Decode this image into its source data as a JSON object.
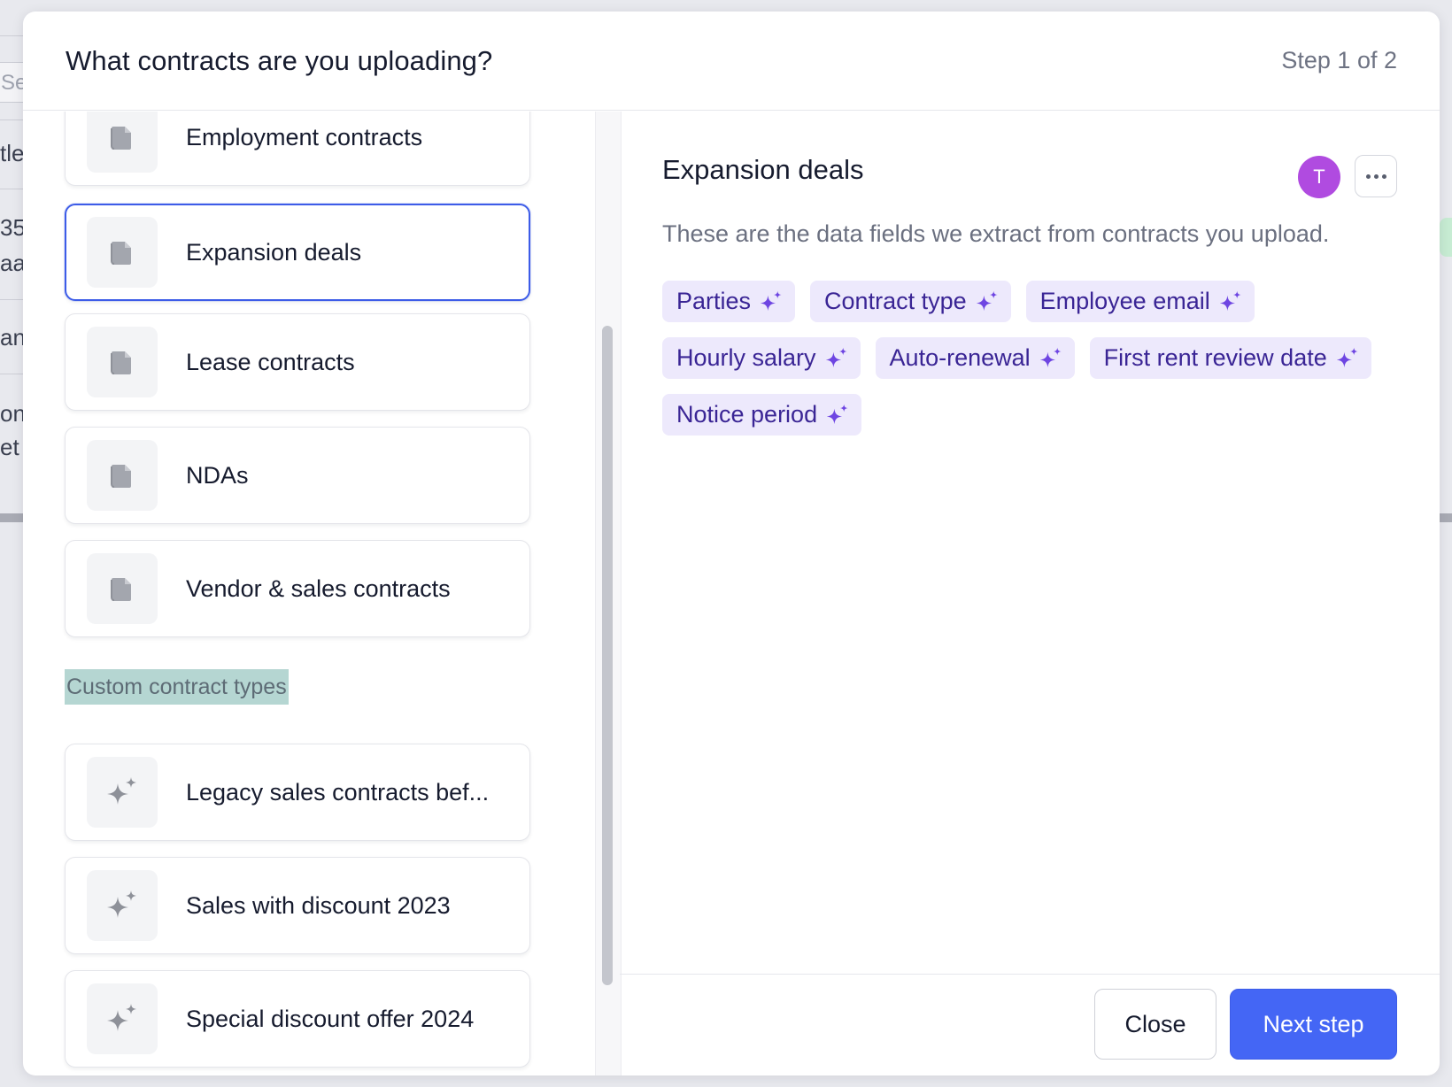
{
  "background": {
    "strips": [
      "Se",
      "tle",
      "35",
      "aa",
      "an",
      "on",
      "et ."
    ]
  },
  "modal": {
    "title": "What contracts are you uploading?",
    "step": "Step 1 of 2"
  },
  "contract_types": [
    {
      "label": "Employment contracts",
      "icon": "document-icon",
      "selected": false
    },
    {
      "label": "Expansion deals",
      "icon": "document-icon",
      "selected": true
    },
    {
      "label": "Lease contracts",
      "icon": "document-icon",
      "selected": false
    },
    {
      "label": "NDAs",
      "icon": "document-icon",
      "selected": false
    },
    {
      "label": "Vendor & sales contracts",
      "icon": "document-icon",
      "selected": false
    }
  ],
  "custom_section": {
    "label": "Custom contract types"
  },
  "custom_types": [
    {
      "label": "Legacy sales contracts bef...",
      "icon": "sparkle-icon"
    },
    {
      "label": "Sales with discount 2023",
      "icon": "sparkle-icon"
    },
    {
      "label": "Special discount offer 2024",
      "icon": "sparkle-icon"
    }
  ],
  "detail": {
    "title": "Expansion deals",
    "avatar_initial": "T",
    "avatar_color": "#b04be0",
    "description": "These are the data fields we extract from contracts you upload.",
    "fields": [
      "Parties",
      "Contract type",
      "Employee email",
      "Hourly salary",
      "Auto-renewal",
      "First rent review date",
      "Notice period"
    ]
  },
  "footer": {
    "close_label": "Close",
    "next_label": "Next step"
  },
  "colors": {
    "accent": "#4466f5",
    "tag_bg": "#ede9fc",
    "tag_text": "#3a2595",
    "sparkle": "#6e45e2"
  }
}
